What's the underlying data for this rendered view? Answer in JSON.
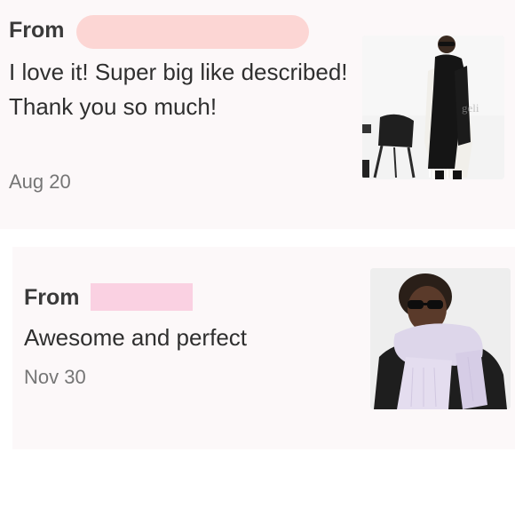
{
  "reviews": [
    {
      "from_label": "From",
      "text": "I love it! Super big like described! Thank you so much!",
      "date": "Aug 20",
      "redaction_color": "#fcd6d4",
      "photo_icon": "black-scarf-photo",
      "watermark": "geli"
    },
    {
      "from_label": "From",
      "text": "Awesome and perfect",
      "date": "Nov 30",
      "redaction_color": "#fad1e2",
      "photo_icon": "lilac-scarf-photo"
    }
  ]
}
